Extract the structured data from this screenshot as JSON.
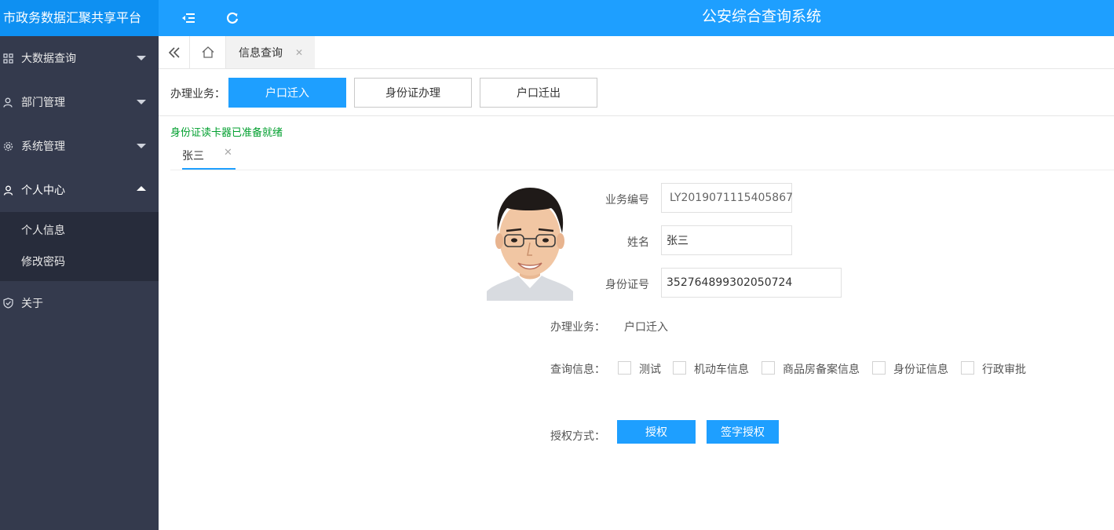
{
  "header": {
    "brand": "市政务数据汇聚共享平台",
    "system_title": "公安综合查询系统",
    "icons": [
      "menu-fold-icon",
      "refresh-icon"
    ],
    "colors": {
      "primary": "#1e9fff",
      "brand_bg": "#0e90f2",
      "sidebar_bg": "#343a4d",
      "submenu_bg": "#272c3b",
      "success_text": "#009f2e"
    }
  },
  "sidebar": {
    "items": [
      {
        "label": "大数据查询",
        "icon": "grid-icon"
      },
      {
        "label": "部门管理",
        "icon": "users-icon"
      },
      {
        "label": "系统管理",
        "icon": "gear-icon"
      },
      {
        "label": "个人中心",
        "icon": "user-icon",
        "expanded": true,
        "children": [
          {
            "label": "个人信息"
          },
          {
            "label": "修改密码"
          }
        ]
      },
      {
        "label": "关于",
        "icon": "shield-icon"
      }
    ]
  },
  "tabs": {
    "active_label": "信息查询"
  },
  "business": {
    "label": "办理业务：",
    "buttons": [
      {
        "label": "户口迁入",
        "active": true
      },
      {
        "label": "身份证办理",
        "active": false
      },
      {
        "label": "户口迁出",
        "active": false
      }
    ]
  },
  "reader_status": "身份证读卡器已准备就绪",
  "person_tab": {
    "name": "张三"
  },
  "form": {
    "business_no_label": "业务编号",
    "business_no_value": "LY2019071115405867",
    "name_label": "姓名",
    "name_value": "张三",
    "id_label": "身份证号",
    "id_value": "352764899302050724",
    "biz_label": "办理业务：",
    "biz_value": "户口迁入",
    "query_label": "查询信息：",
    "query_options": [
      {
        "label": "测试",
        "checked": false
      },
      {
        "label": "机动车信息",
        "checked": false
      },
      {
        "label": "商品房备案信息",
        "checked": false
      },
      {
        "label": "身份证信息",
        "checked": false
      },
      {
        "label": "行政审批",
        "checked": false
      }
    ],
    "auth_label": "授权方式：",
    "auth_buttons": [
      "授权",
      "签字授权"
    ]
  }
}
